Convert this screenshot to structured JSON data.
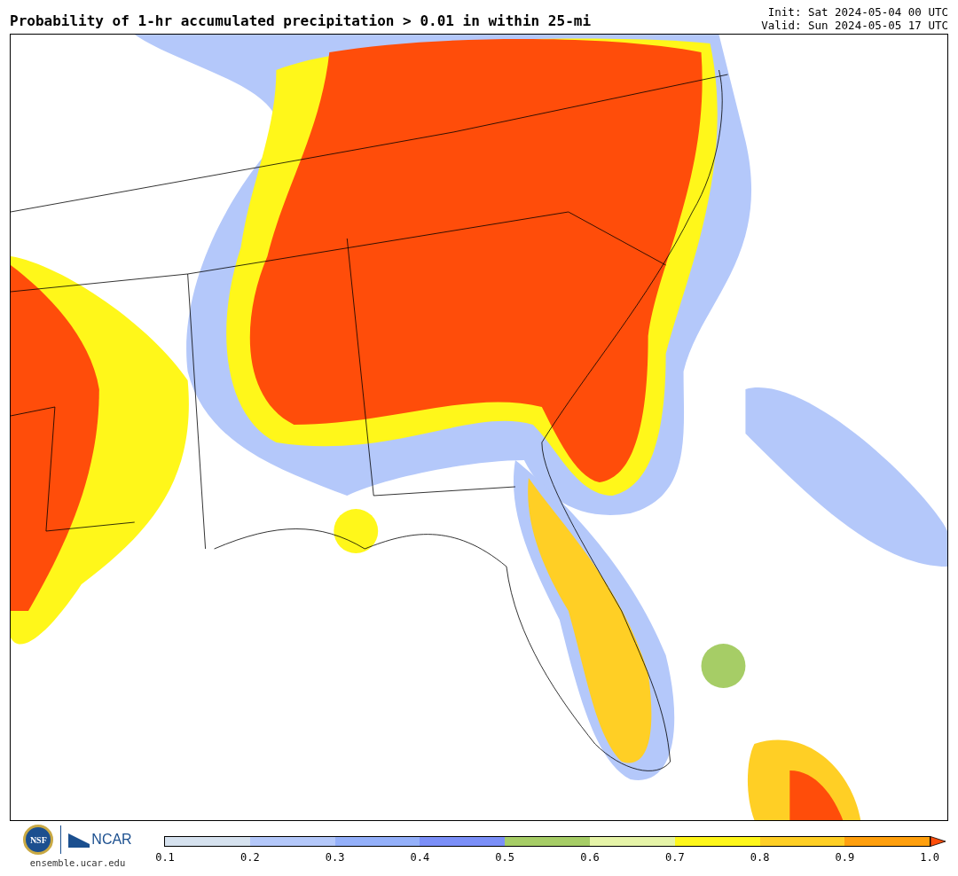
{
  "title": "Probability of 1-hr accumulated precipitation > 0.01 in within 25-mi",
  "init": "Init: Sat 2024-05-04 00 UTC",
  "valid": "Valid: Sun 2024-05-05 17 UTC",
  "logo": {
    "seal": "NSF",
    "name": "NCAR",
    "url": "ensemble.ucar.edu"
  },
  "colorbar": {
    "bins": [
      {
        "kind": "box",
        "color": "#d6e2ef"
      },
      {
        "kind": "box",
        "color": "#b4c8fa"
      },
      {
        "kind": "box",
        "color": "#94b0fa"
      },
      {
        "kind": "box",
        "color": "#7b8ff8"
      },
      {
        "kind": "box",
        "color": "#a6cd66"
      },
      {
        "kind": "box",
        "color": "#e6f4a8"
      },
      {
        "kind": "box",
        "color": "#fff71a"
      },
      {
        "kind": "box",
        "color": "#ffcf25"
      },
      {
        "kind": "box",
        "color": "#ff9f0d"
      },
      {
        "kind": "arrow",
        "color": "#ff4d0a"
      }
    ],
    "ticks": [
      "0.1",
      "0.2",
      "0.3",
      "0.4",
      "0.5",
      "0.6",
      "0.7",
      "0.8",
      "0.9",
      "1.0"
    ]
  }
}
